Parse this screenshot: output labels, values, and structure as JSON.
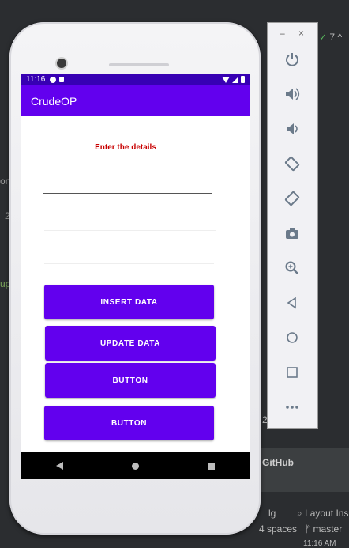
{
  "ide": {
    "github_label": "GitHub",
    "layout_label": "Layout Inspe",
    "lg_label": "lg",
    "indent_label": "4 spaces",
    "branch_label": "master",
    "clock_label": "11:16 AM",
    "left_fragment_1": "on",
    "left_fragment_2": "up",
    "left_fragment_3": "2",
    "top_right_count": "7",
    "num_2": "2"
  },
  "status_bar": {
    "time": "11:16"
  },
  "app": {
    "title": "CrudeOP",
    "details_label": "Enter the details",
    "buttons": {
      "insert": "INSERT DATA",
      "update": "UPDATE DATA",
      "button1": "BUTTON",
      "button2": "BUTTON"
    }
  },
  "colors": {
    "primary": "#6200ee",
    "primary_dark": "#3700b3",
    "label_red": "#c80000"
  },
  "emulator_toolbar": {
    "minimize_label": "–",
    "close_label": "×",
    "icons": [
      "power-icon",
      "volume-up-icon",
      "volume-down-icon",
      "rotate-left-icon",
      "rotate-right-icon",
      "camera-icon",
      "zoom-icon",
      "back-icon",
      "home-icon",
      "overview-icon",
      "more-icon"
    ]
  }
}
